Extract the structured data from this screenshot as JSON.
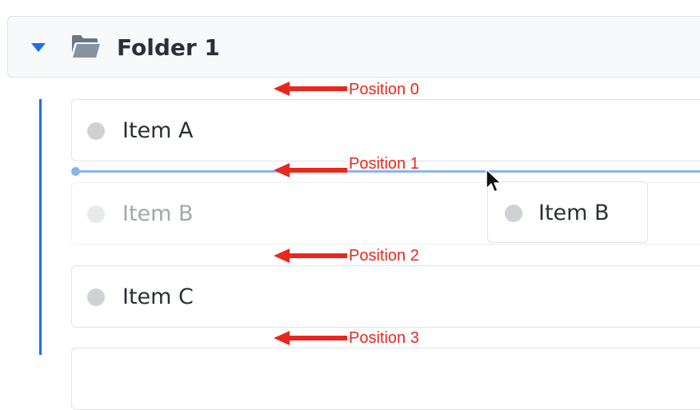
{
  "folder": {
    "label": "Folder 1",
    "expanded": true
  },
  "items": [
    {
      "label": "Item A",
      "state": "normal"
    },
    {
      "label": "Item B",
      "state": "placeholder"
    },
    {
      "label": "Item C",
      "state": "normal"
    }
  ],
  "drag_preview": {
    "label": "Item B"
  },
  "annotations": [
    {
      "label": "Position 0"
    },
    {
      "label": "Position 1"
    },
    {
      "label": "Position 2"
    },
    {
      "label": "Position 3"
    }
  ],
  "colors": {
    "accent": "#1f6fe0",
    "drop_indicator": "#8ab4f0",
    "annotation": "#e8281e"
  },
  "icons": {
    "caret": "caret-down-icon",
    "folder": "folder-open-icon",
    "cursor": "mouse-pointer-icon"
  }
}
